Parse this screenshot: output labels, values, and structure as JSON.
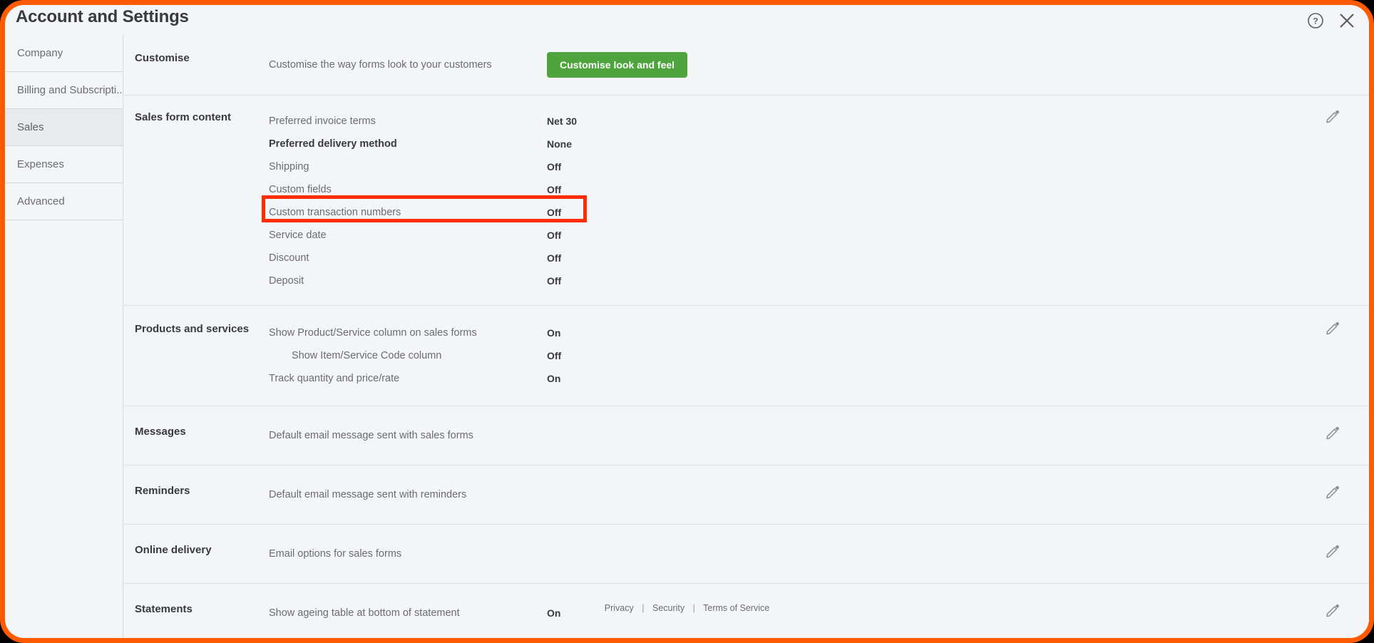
{
  "window": {
    "title": "Account and Settings",
    "help_icon": "question-circle-icon",
    "close_icon": "close-icon",
    "frame_color": "#ff5a00"
  },
  "sidebar": {
    "items": [
      {
        "label": "Company",
        "active": false
      },
      {
        "label": "Billing and Subscripti...",
        "active": false
      },
      {
        "label": "Sales",
        "active": true
      },
      {
        "label": "Expenses",
        "active": false
      },
      {
        "label": "Advanced",
        "active": false
      }
    ]
  },
  "sections": [
    {
      "title": "Customise",
      "rows": [
        {
          "label": "Customise the way forms look to your customers",
          "value": "",
          "button": "Customise look and feel"
        }
      ],
      "edit_icon": false
    },
    {
      "title": "Sales form content",
      "rows": [
        {
          "label": "Preferred invoice terms",
          "value": "Net 30",
          "strong": false
        },
        {
          "label": "Preferred delivery method",
          "value": "None",
          "strong": true
        },
        {
          "label": "Shipping",
          "value": "Off",
          "strong": false
        },
        {
          "label": "Custom fields",
          "value": "Off",
          "strong": false
        },
        {
          "label": "Custom transaction numbers",
          "value": "Off",
          "strong": false,
          "highlighted": true
        },
        {
          "label": "Service date",
          "value": "Off",
          "strong": false
        },
        {
          "label": "Discount",
          "value": "Off",
          "strong": false
        },
        {
          "label": "Deposit",
          "value": "Off",
          "strong": false
        }
      ],
      "edit_icon": true
    },
    {
      "title": "Products and services",
      "rows": [
        {
          "label": "Show Product/Service column on sales forms",
          "value": "On",
          "indent": false
        },
        {
          "label": "Show Item/Service Code column",
          "value": "Off",
          "indent": true
        },
        {
          "label": "Track quantity and price/rate",
          "value": "On",
          "indent": false
        }
      ],
      "edit_icon": true
    },
    {
      "title": "Messages",
      "rows": [
        {
          "label": "Default email message sent with sales forms",
          "value": ""
        }
      ],
      "edit_icon": true
    },
    {
      "title": "Reminders",
      "rows": [
        {
          "label": "Default email message sent with reminders",
          "value": ""
        }
      ],
      "edit_icon": true
    },
    {
      "title": "Online delivery",
      "rows": [
        {
          "label": "Email options for sales forms",
          "value": ""
        }
      ],
      "edit_icon": true
    },
    {
      "title": "Statements",
      "rows": [
        {
          "label": "Show ageing table at bottom of statement",
          "value": "On"
        }
      ],
      "edit_icon": true
    }
  ],
  "footer": {
    "privacy": "Privacy",
    "security": "Security",
    "terms": "Terms of Service",
    "separator": "|"
  },
  "colors": {
    "accent_button": "#4fa43d",
    "highlight_box": "#ff2d00",
    "frame": "#ff5a00",
    "panel_bg": "#f4f5f7"
  }
}
